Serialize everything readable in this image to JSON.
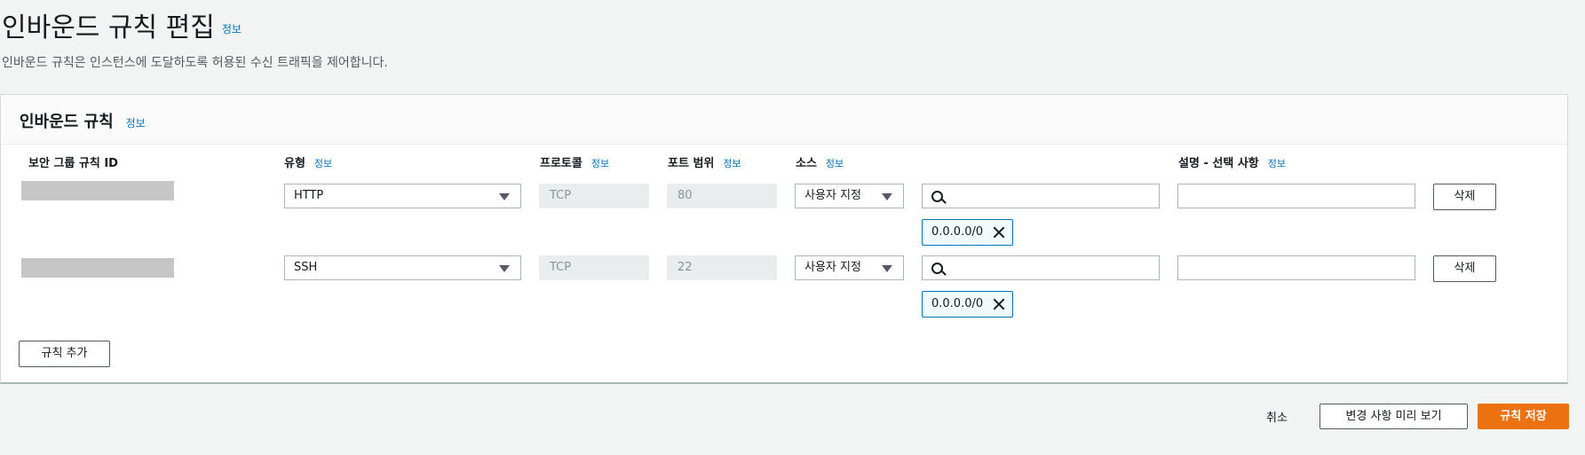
{
  "page": {
    "title": "인바운드 규칙 편집",
    "title_info": "정보",
    "description": "인바운드 규칙은 인스턴스에 도달하도록 허용된 수신 트래픽을 제어합니다."
  },
  "panel": {
    "title": "인바운드 규칙",
    "title_info": "정보",
    "columns": {
      "rule_id": "보안 그룹 규칙 ID",
      "type": "유형",
      "protocol": "프로토콜",
      "port_range": "포트 범위",
      "source": "소스",
      "description": "설명 - 선택 사항",
      "info": "정보"
    },
    "rules": [
      {
        "type": "HTTP",
        "protocol": "TCP",
        "port_range": "80",
        "source_type": "사용자 지정",
        "source_search": "",
        "source_token": "0.0.0.0/0",
        "description": "",
        "delete_label": "삭제"
      },
      {
        "type": "SSH",
        "protocol": "TCP",
        "port_range": "22",
        "source_type": "사용자 지정",
        "source_search": "",
        "source_token": "0.0.0.0/0",
        "description": "",
        "delete_label": "삭제"
      }
    ],
    "add_rule_label": "규칙 추가"
  },
  "footer": {
    "cancel_label": "취소",
    "preview_label": "변경 사항 미리 보기",
    "save_label": "규칙 저장"
  },
  "colors": {
    "accent": "#0073bb",
    "primary": "#ec7211"
  }
}
